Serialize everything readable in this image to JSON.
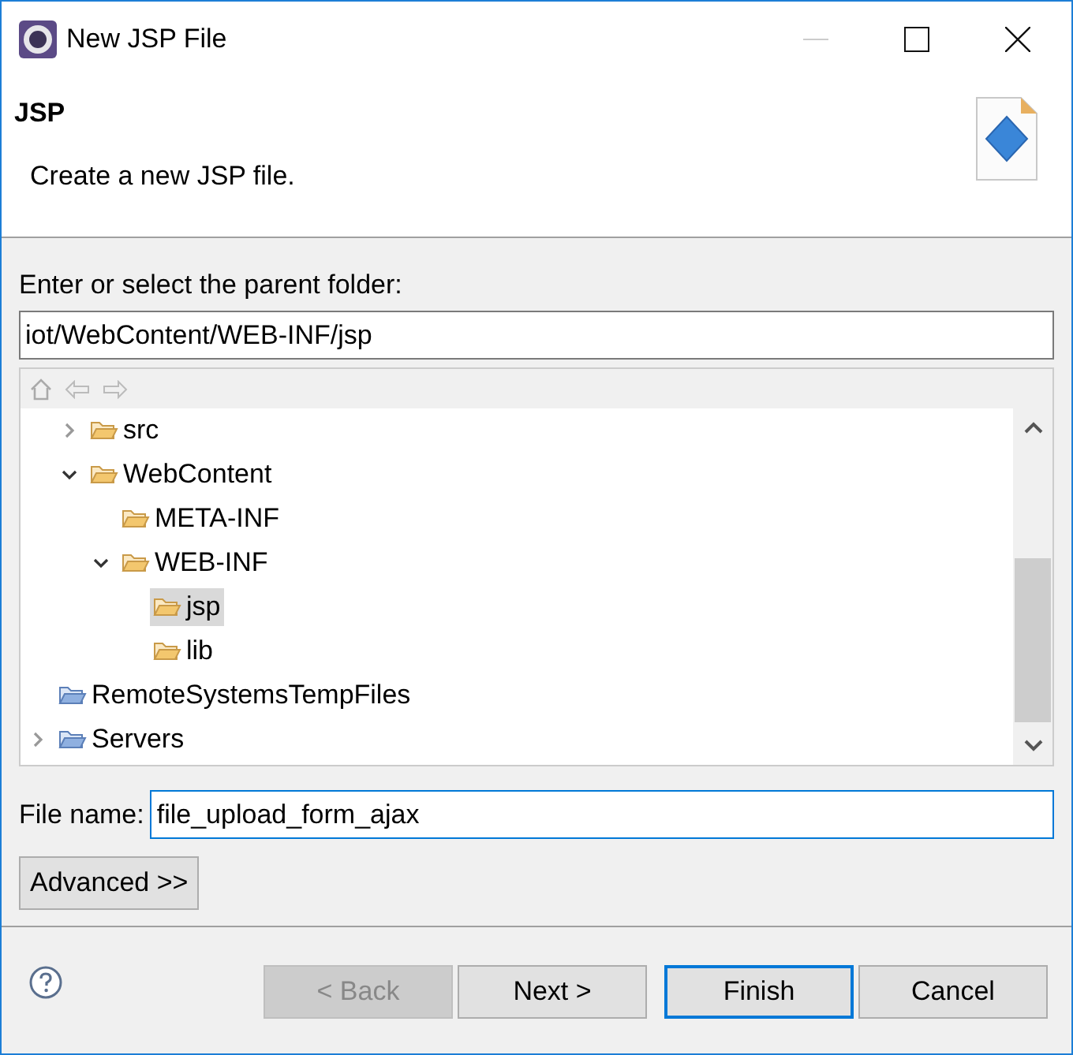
{
  "window": {
    "title": "New JSP File"
  },
  "header": {
    "title": "JSP",
    "description": "Create a new JSP file."
  },
  "folder_label": "Enter or select the parent folder:",
  "folder_path": "iot/WebContent/WEB-INF/jsp",
  "tree": {
    "items": [
      {
        "children": [
          {
            "label": "src",
            "kind": "folder",
            "expanded": false,
            "selected": false
          },
          {
            "label": "WebContent",
            "kind": "folder",
            "expanded": true,
            "selected": false,
            "children": [
              {
                "label": "META-INF",
                "kind": "folder",
                "selected": false
              },
              {
                "label": "WEB-INF",
                "kind": "folder",
                "expanded": true,
                "selected": false,
                "children": [
                  {
                    "label": "jsp",
                    "kind": "folder",
                    "selected": true
                  },
                  {
                    "label": "lib",
                    "kind": "folder",
                    "selected": false
                  }
                ]
              }
            ]
          }
        ]
      },
      {
        "label": "RemoteSystemsTempFiles",
        "kind": "project",
        "selected": false
      },
      {
        "label": "Servers",
        "kind": "project",
        "expanded": false,
        "selected": false
      }
    ]
  },
  "file_name": {
    "label": "File name:",
    "value": "file_upload_form_ajax"
  },
  "advanced_button": "Advanced >>",
  "buttons": [
    {
      "label": "< Back",
      "disabled": true,
      "default": false
    },
    {
      "label": "Next >",
      "disabled": false,
      "default": false
    },
    {
      "label": "Finish",
      "disabled": false,
      "default": true
    },
    {
      "label": "Cancel",
      "disabled": false,
      "default": false
    }
  ]
}
